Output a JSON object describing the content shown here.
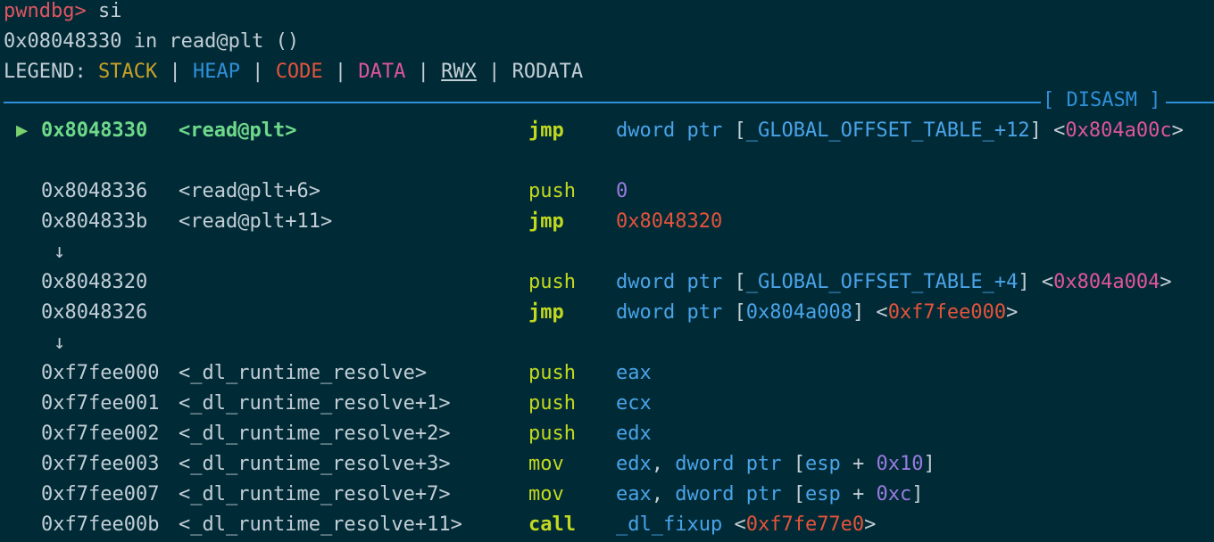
{
  "prompt": {
    "name": "pwndbg",
    "caret": ">",
    "command": " si"
  },
  "location_line": "0x08048330 in read@plt ()",
  "legend": {
    "label": "LEGEND: ",
    "stack": "STACK",
    "heap": "HEAP",
    "code": "CODE",
    "data": "DATA",
    "rwx": "RWX",
    "rodata": "RODATA",
    "sep": " | "
  },
  "section_title": "[ DISASM ]",
  "colors": {
    "background": "#002b36",
    "prompt": "#e05561",
    "stack": "#c9a227",
    "heap": "#2f8fd8",
    "code": "#e5533b",
    "data": "#e0559a",
    "mnemonic": "#c2d91f",
    "current": "#6fd98a",
    "number": "#9a7be0"
  },
  "current_marker": "▶",
  "flow_arrow": "↓",
  "disasm": [
    {
      "addr": "0x8048330",
      "sym": "<read@plt>",
      "mnem": "jmp",
      "current": true,
      "ops": [
        [
          "c-kw",
          "dword ptr"
        ],
        [
          "c-plain",
          " ["
        ],
        [
          "c-sym",
          "_GLOBAL_OFFSET_TABLE_+12"
        ],
        [
          "c-plain",
          "] <"
        ],
        [
          "c-data",
          "0x804a00c"
        ],
        [
          "c-plain",
          ">"
        ]
      ]
    },
    {
      "addr": "0x8048336",
      "sym": "<read@plt+6>",
      "mnem": "push",
      "ops": [
        [
          "c-num",
          "0"
        ]
      ]
    },
    {
      "addr": "0x804833b",
      "sym": "<read@plt+11>",
      "mnem": "jmp",
      "ops": [
        [
          "c-code",
          "0x8048320"
        ]
      ]
    },
    {
      "addr": "0x8048320",
      "sym": "",
      "mnem": "push",
      "ops": [
        [
          "c-kw",
          "dword ptr"
        ],
        [
          "c-plain",
          " ["
        ],
        [
          "c-sym",
          "_GLOBAL_OFFSET_TABLE_+4"
        ],
        [
          "c-plain",
          "] <"
        ],
        [
          "c-data",
          "0x804a004"
        ],
        [
          "c-plain",
          ">"
        ]
      ]
    },
    {
      "addr": "0x8048326",
      "sym": "",
      "mnem": "jmp",
      "ops": [
        [
          "c-kw",
          "dword ptr"
        ],
        [
          "c-plain",
          " ["
        ],
        [
          "c-sym",
          "0x804a008"
        ],
        [
          "c-plain",
          "] <"
        ],
        [
          "c-code",
          "0xf7fee000"
        ],
        [
          "c-plain",
          ">"
        ]
      ]
    },
    {
      "addr": "0xf7fee000",
      "sym": "<_dl_runtime_resolve>",
      "mnem": "push",
      "ops": [
        [
          "c-reg",
          "eax"
        ]
      ]
    },
    {
      "addr": "0xf7fee001",
      "sym": "<_dl_runtime_resolve+1>",
      "mnem": "push",
      "ops": [
        [
          "c-reg",
          "ecx"
        ]
      ]
    },
    {
      "addr": "0xf7fee002",
      "sym": "<_dl_runtime_resolve+2>",
      "mnem": "push",
      "ops": [
        [
          "c-reg",
          "edx"
        ]
      ]
    },
    {
      "addr": "0xf7fee003",
      "sym": "<_dl_runtime_resolve+3>",
      "mnem": "mov",
      "ops": [
        [
          "c-reg",
          "edx"
        ],
        [
          "c-plain",
          ", "
        ],
        [
          "c-kw",
          "dword ptr"
        ],
        [
          "c-plain",
          " ["
        ],
        [
          "c-reg",
          "esp"
        ],
        [
          "c-plain",
          " + "
        ],
        [
          "c-num",
          "0x10"
        ],
        [
          "c-plain",
          "]"
        ]
      ]
    },
    {
      "addr": "0xf7fee007",
      "sym": "<_dl_runtime_resolve+7>",
      "mnem": "mov",
      "ops": [
        [
          "c-reg",
          "eax"
        ],
        [
          "c-plain",
          ", "
        ],
        [
          "c-kw",
          "dword ptr"
        ],
        [
          "c-plain",
          " ["
        ],
        [
          "c-reg",
          "esp"
        ],
        [
          "c-plain",
          " + "
        ],
        [
          "c-num",
          "0xc"
        ],
        [
          "c-plain",
          "]"
        ]
      ]
    },
    {
      "addr": "0xf7fee00b",
      "sym": "<_dl_runtime_resolve+11>",
      "mnem": "call",
      "ops": [
        [
          "c-sym",
          "_dl_fixup"
        ],
        [
          "c-plain",
          " <"
        ],
        [
          "c-code",
          "0xf7fe77e0"
        ],
        [
          "c-plain",
          ">"
        ]
      ]
    }
  ]
}
